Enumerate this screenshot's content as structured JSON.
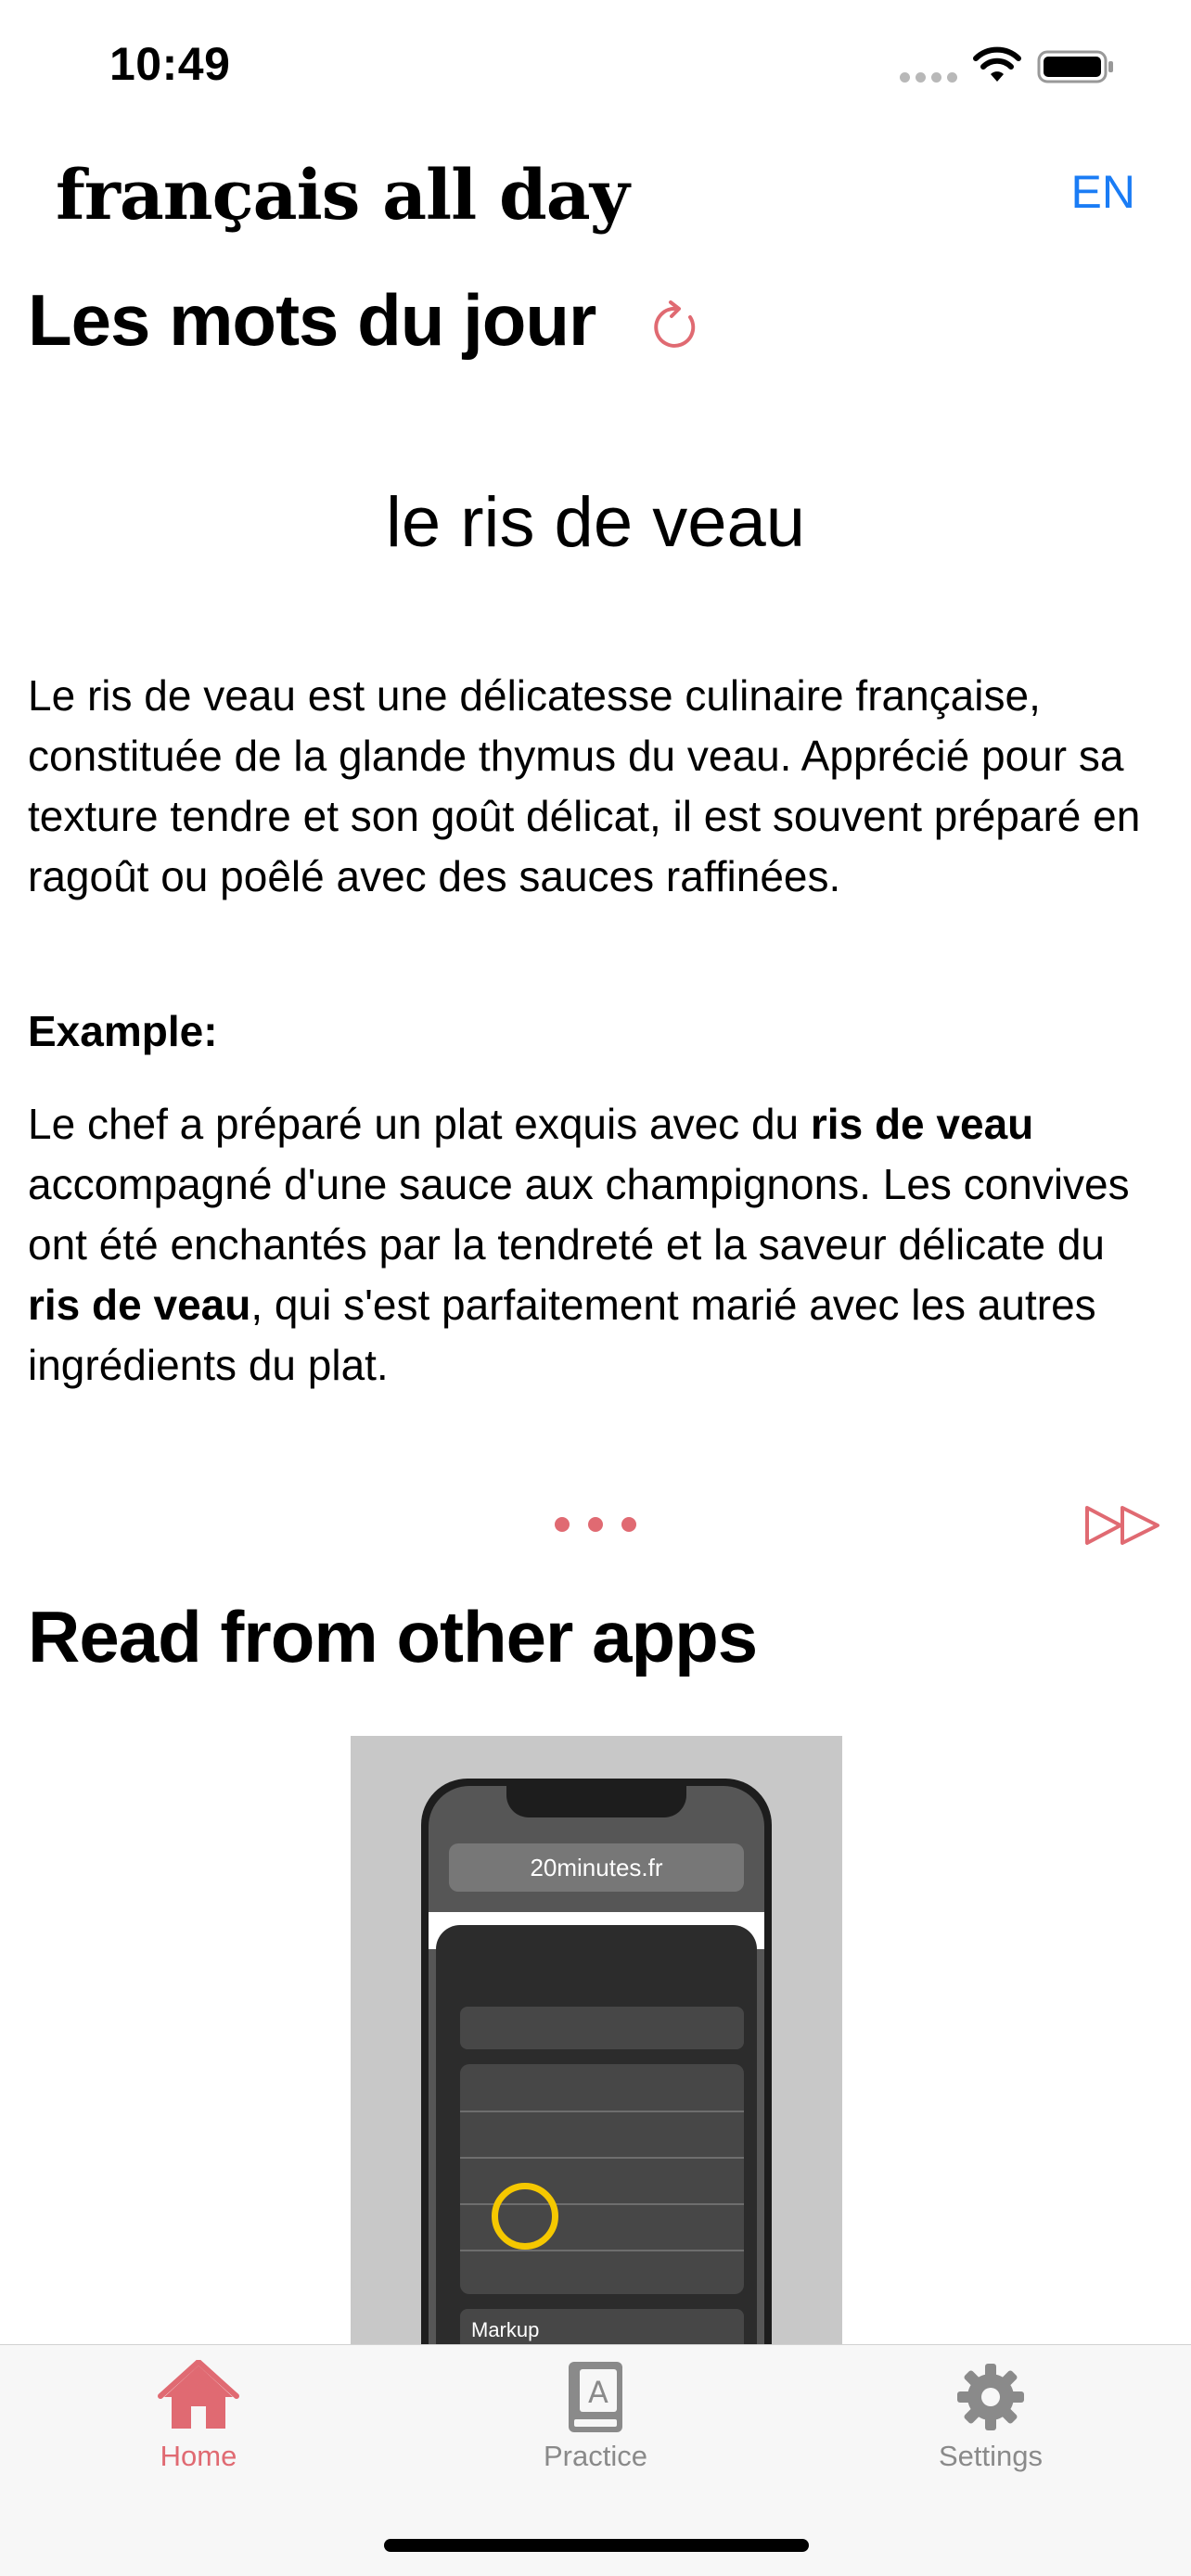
{
  "status_bar": {
    "time": "10:49"
  },
  "header": {
    "brand": "français all day",
    "lang_toggle": "EN"
  },
  "daily_words": {
    "title": "Les mots du jour",
    "word": "le ris de veau",
    "definition": "Le ris de veau est une délicatesse culinaire française, constituée de la glande thymus du veau. Apprécié pour sa texture tendre et son goût délicat, il est souvent préparé en ragoût ou poêlé avec des sauces raffinées.",
    "example_label": "Example:",
    "example_parts": [
      "Le chef a préparé un plat exquis avec du ",
      "ris de veau",
      " accompagné d'une sauce aux champignons. Les convives ont été enchantés par la tendreté et la saveur délicate du ",
      "ris de veau",
      ", qui s'est parfaitement marié avec les autres ingrédients du plat."
    ]
  },
  "read_other_apps": {
    "title": "Read from other apps",
    "promo_url": "20minutes.fr",
    "promo_markup": "Markup"
  },
  "tab_bar": {
    "tabs": [
      {
        "label": "Home",
        "icon": "house-icon",
        "active": true
      },
      {
        "label": "Practice",
        "icon": "book-icon",
        "active": false
      },
      {
        "label": "Settings",
        "icon": "gear-icon",
        "active": false
      }
    ]
  },
  "colors": {
    "accent": "#e06a72",
    "link": "#1a7cf5",
    "inactive": "#8a8a8a"
  }
}
